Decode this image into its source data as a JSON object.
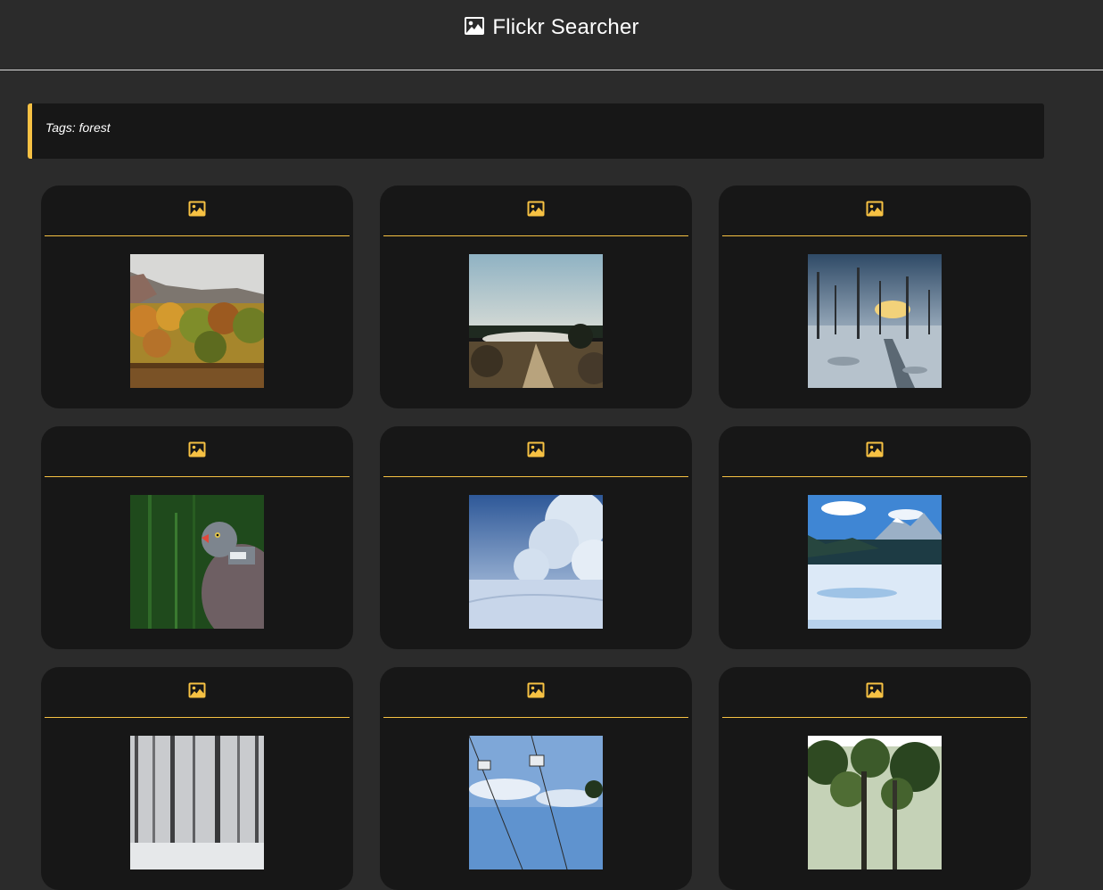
{
  "header": {
    "title": "Flickr Searcher",
    "icon": "image-icon"
  },
  "tags_bar": {
    "text": "Tags: forest"
  },
  "colors": {
    "accent": "#f6c143",
    "background": "#2b2b2b",
    "card": "#171717"
  },
  "photos": [
    {
      "icon": "image-icon",
      "subject": "autumn-forest-lake"
    },
    {
      "icon": "image-icon",
      "subject": "misty-valley-road"
    },
    {
      "icon": "image-icon",
      "subject": "snowy-dead-trees-sunset"
    },
    {
      "icon": "image-icon",
      "subject": "wood-pigeon"
    },
    {
      "icon": "image-icon",
      "subject": "snow-covered-branches"
    },
    {
      "icon": "image-icon",
      "subject": "snowy-mountains-forest"
    },
    {
      "icon": "image-icon",
      "subject": "snowy-birch-forest"
    },
    {
      "icon": "image-icon",
      "subject": "ski-lift-chairs"
    },
    {
      "icon": "image-icon",
      "subject": "green-forest-canopy"
    }
  ]
}
